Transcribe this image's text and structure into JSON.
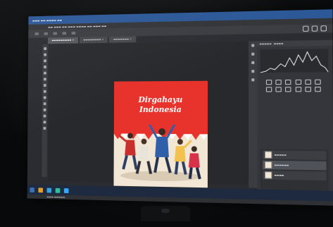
{
  "photo": {
    "subject": "photograph of a computer monitor showing an image editor",
    "colors": {
      "art_red": "#e8322c",
      "art_cream": "#f2e7d5",
      "ui_dark": "#2a2c31"
    }
  },
  "artwork": {
    "title_line1": "Dirgahayu",
    "title_line2": "Indonesia"
  }
}
